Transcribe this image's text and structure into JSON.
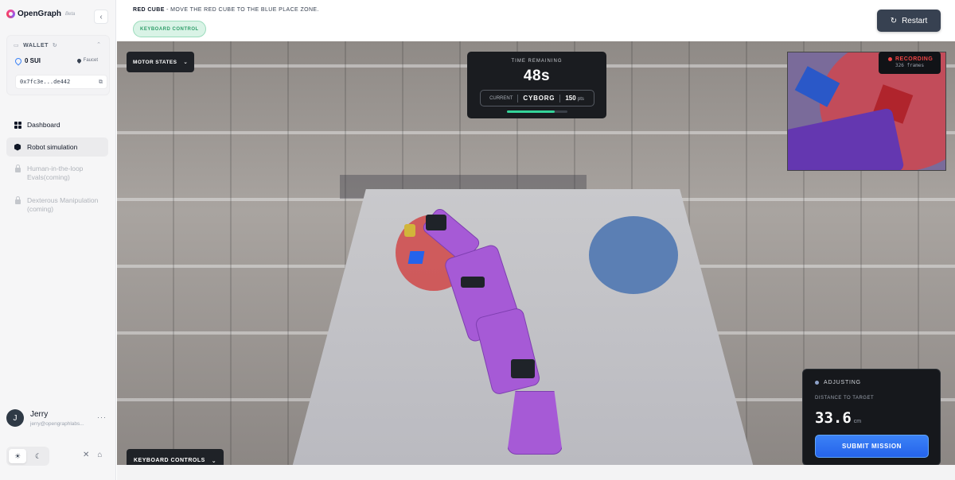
{
  "brand": {
    "name": "OpenGraph",
    "tag": "Beta"
  },
  "icons": {
    "collapse": "chevron-left-icon",
    "wallet": "wallet-icon",
    "refresh": "refresh-icon",
    "sui": "sui-drop-icon",
    "faucet": "faucet-drop-icon",
    "external": "external-link-icon",
    "restart": "restart-icon",
    "sun": "sun-icon",
    "moon": "moon-icon",
    "x": "x-logo-icon",
    "home": "home-icon"
  },
  "wallet": {
    "title": "WALLET",
    "balance": "0 SUI",
    "faucet_label": "Faucet",
    "address": "0x7fc3e...de442"
  },
  "nav": {
    "items": [
      {
        "label": "Dashboard",
        "icon": "grid-icon",
        "active": false
      },
      {
        "label": "Robot simulation",
        "icon": "hexagon-icon",
        "active": true
      },
      {
        "label": "Human-in-the-loop Evals(coming)",
        "icon": "lock-icon",
        "disabled": true
      },
      {
        "label": "Dexterous Manipulation (coming)",
        "icon": "lock-icon",
        "disabled": true
      }
    ]
  },
  "user": {
    "initial": "J",
    "name": "Jerry",
    "email": "jerry@opengraphlabs..."
  },
  "header": {
    "task_title": "RED CUBE",
    "task_desc": " - MOVE THE RED CUBE TO THE BLUE PLACE ZONE.",
    "mode_pill": "KEYBOARD CONTROL",
    "restart_label": "Restart"
  },
  "viewport": {
    "motor_states_label": "MOTOR STATES",
    "keyboard_controls_label": "KEYBOARD CONTROLS",
    "timer": {
      "label": "TIME REMAINING",
      "value": "48s",
      "current_label": "CURRENT",
      "agent": "CYBORG",
      "points": "150",
      "points_unit": "pts",
      "progress": 0.8
    },
    "recording": {
      "label": "RECORDING",
      "frames": "326 frames"
    },
    "status": {
      "state": "ADJUSTING",
      "distance_label": "DISTANCE TO TARGET",
      "distance_value": "33.6",
      "distance_unit": "cm",
      "submit_label": "SUBMIT MISSION"
    }
  },
  "colors": {
    "accent_green": "#34d399",
    "submit_blue": "#2563eb",
    "recording_red": "#ef4444",
    "panel_dark": "#1a1c20"
  }
}
